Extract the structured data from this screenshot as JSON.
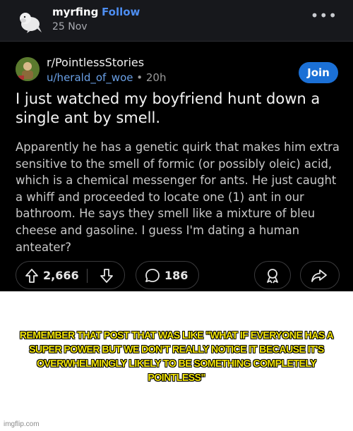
{
  "tumblr": {
    "username": "myrfing",
    "follow_label": "Follow",
    "date": "25 Nov",
    "more_icon": "more-dots-icon"
  },
  "reddit": {
    "subreddit": "r/PointlessStories",
    "author": "u/herald_of_woe",
    "age": "• 20h",
    "join_label": "Join",
    "title": "I just watched my boyfriend hunt down a single ant by smell.",
    "body": "Apparently he has a genetic quirk that makes him extra sensitive to the smell of formic (or possibly oleic) acid, which is a chemical messenger for ants. He just caught a whiff and proceeded to locate one (1) ant in our bathroom. He says they smell like a mixture of bleu cheese and gasoline. I guess I'm dating a human anteater?",
    "upvotes": "2,666",
    "comments": "186"
  },
  "caption": "REMEMBER THAT POST THAT WAS LIKE \"WHAT IF EVERYONE HAS A SUPER POWER BUT WE DON'T REALLY NOTICE IT BECAUSE IT'S OVERWHELMINGLY LIKELY TO BE SOMETHING COMPLETELY POINTLESS\"",
  "watermark": "imgflip.com",
  "colors": {
    "accent_blue": "#1b70d6",
    "follow_blue": "#4d8df0",
    "caption_yellow": "#f2e409"
  }
}
